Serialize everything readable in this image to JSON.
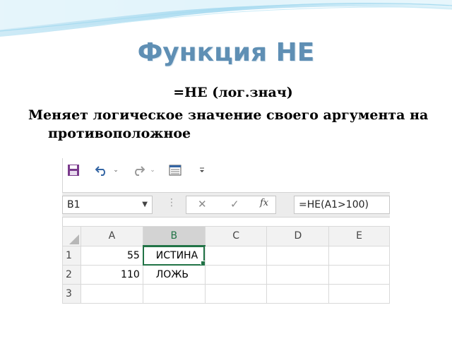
{
  "slide": {
    "title": "Функция НЕ",
    "formula": "=НЕ (лог.знач)",
    "description": "Меняет логическое значение своего аргумента на противоположное",
    "accent_color": "#5f8fb4"
  },
  "excel": {
    "quick_access": {
      "icons": [
        "save-icon",
        "undo-icon",
        "undo-dropdown-icon",
        "redo-icon",
        "redo-dropdown-icon",
        "form-icon",
        "customize-qat-icon"
      ]
    },
    "formula_bar": {
      "name_box": "B1",
      "cancel_icon": "✕",
      "enter_icon": "✓",
      "fx_label": "fx",
      "formula": "=НЕ(A1>100)"
    },
    "columns": [
      "A",
      "B",
      "C",
      "D",
      "E"
    ],
    "selected_column": "B",
    "rows": [
      {
        "header": "1",
        "cells": [
          "55",
          "ИСТИНА",
          "",
          "",
          ""
        ]
      },
      {
        "header": "2",
        "cells": [
          "110",
          "ЛОЖЬ",
          "",
          "",
          ""
        ]
      },
      {
        "header": "3",
        "cells": [
          "",
          "",
          "",
          "",
          ""
        ]
      }
    ],
    "active_cell": "B1",
    "accent_color": "#217346"
  }
}
